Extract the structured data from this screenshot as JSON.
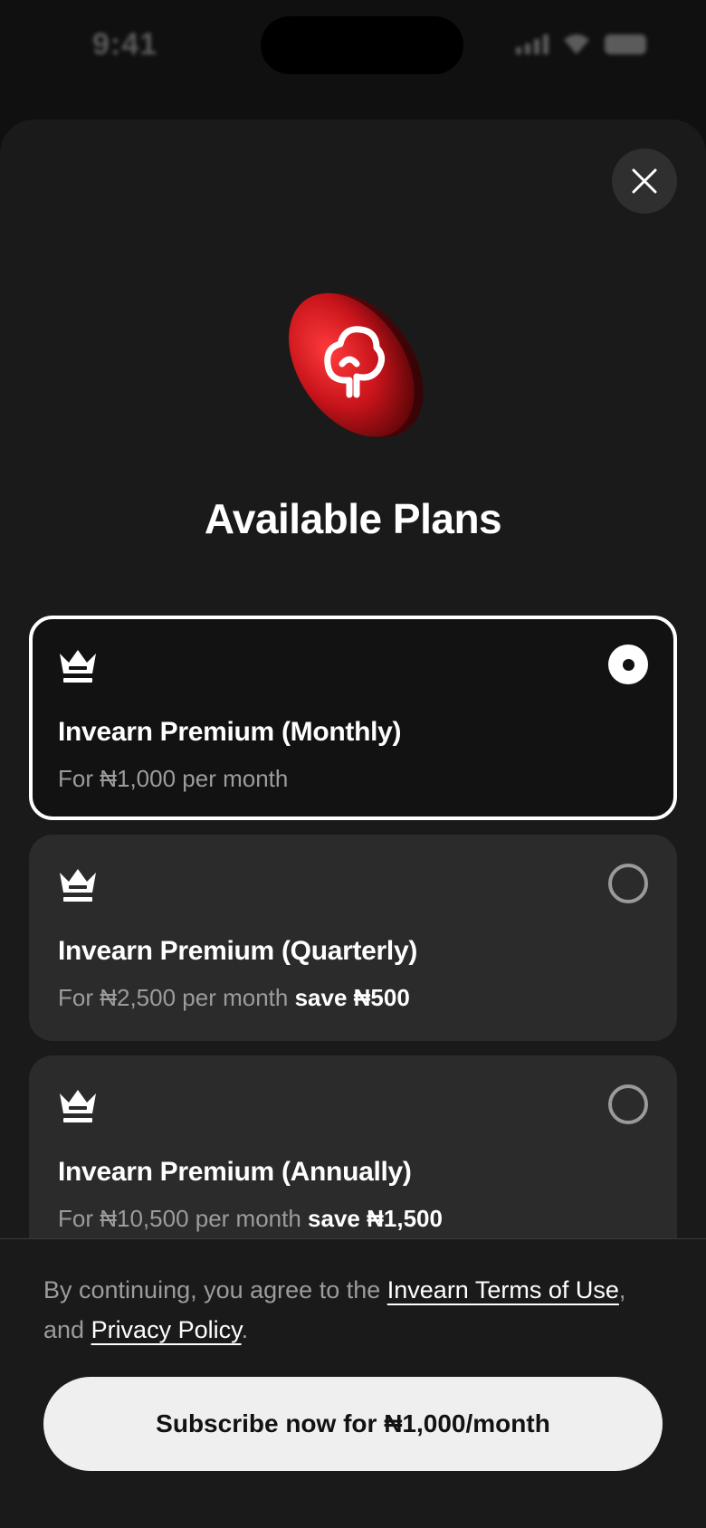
{
  "status_bar": {
    "time": "9:41"
  },
  "sheet": {
    "title": "Available Plans",
    "close_icon": "close-icon",
    "logo_icon": "invearn-coin-logo"
  },
  "plans": [
    {
      "name": "Invearn Premium (Monthly)",
      "price": "For ₦1,000 per month",
      "save": "",
      "selected": true,
      "icon": "crown-icon"
    },
    {
      "name": "Invearn Premium (Quarterly)",
      "price": "For ₦2,500 per month",
      "save": "save ₦500",
      "selected": false,
      "icon": "crown-icon"
    },
    {
      "name": "Invearn Premium (Annually)",
      "price": "For ₦10,500 per month",
      "save": "save ₦1,500",
      "selected": false,
      "icon": "crown-icon"
    }
  ],
  "footer": {
    "legal_prefix": "By continuing, you agree to the ",
    "terms_link": "Invearn Terms of Use",
    "legal_middle": ", and ",
    "privacy_link": "Privacy Policy",
    "legal_suffix": ".",
    "subscribe_label": "Subscribe now for ₦1,000/month"
  },
  "colors": {
    "background": "#101010",
    "sheet": "#1a1a1a",
    "card": "#2b2b2b",
    "accent_red": "#c8141b",
    "button": "#efefef"
  }
}
